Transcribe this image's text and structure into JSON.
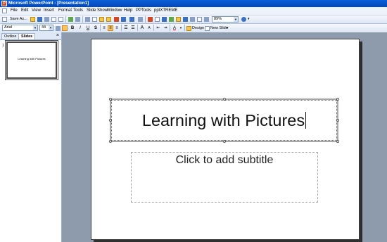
{
  "window": {
    "title": "Microsoft PowerPoint - [Presentation1]"
  },
  "menu": [
    "File",
    "Edit",
    "View",
    "Insert",
    "Format",
    "Tools",
    "Slide Show",
    "Window",
    "Help",
    "PPTools",
    "pptXTREME"
  ],
  "toolbar": {
    "save_as_label": "Save As...",
    "zoom_value": "89%"
  },
  "formatting": {
    "font_name": "Arial",
    "font_size": "44",
    "bold": "B",
    "italic": "I",
    "underline": "U",
    "shadow": "S",
    "grow_font": "A",
    "shrink_font": "A",
    "font_color": "A",
    "design_label": "Design",
    "new_slide_label": "New Slide"
  },
  "left_pane": {
    "tabs": [
      "Outline",
      "Slides"
    ],
    "active_tab": "Slides",
    "close_glyph": "×",
    "slide_number": "1",
    "thumbnail_title": "Learning with Pictures"
  },
  "slide": {
    "title": "Learning with Pictures",
    "subtitle_placeholder": "Click to add subtitle"
  },
  "icons": [
    "powerpoint-icon",
    "document-icon",
    "new-icon",
    "open-icon",
    "save-icon",
    "print-icon",
    "spelling-icon",
    "cut-icon",
    "copy-icon",
    "paste-icon",
    "format-painter-icon",
    "undo-icon",
    "redo-icon",
    "chart-icon",
    "table-icon",
    "grid-icon",
    "help-icon"
  ]
}
